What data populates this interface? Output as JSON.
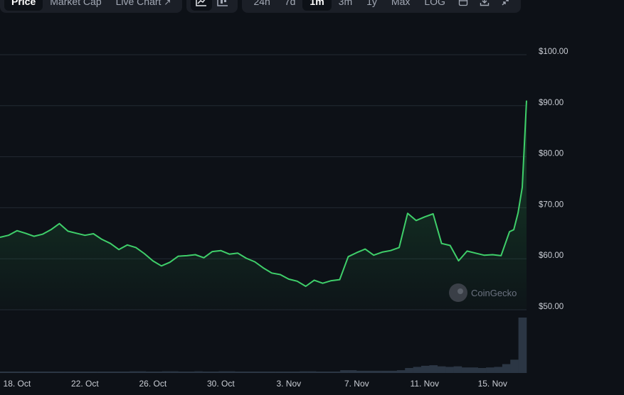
{
  "toolbar": {
    "view_tabs": [
      {
        "label": "Price",
        "active": true
      },
      {
        "label": "Market Cap",
        "active": false
      },
      {
        "label": "Live Chart",
        "active": false
      }
    ],
    "chart_type_icons": [
      {
        "icon": "line-chart-icon",
        "active": true
      },
      {
        "icon": "candlestick-chart-icon",
        "active": false
      }
    ],
    "ranges": [
      {
        "label": "24h",
        "active": false
      },
      {
        "label": "7d",
        "active": false
      },
      {
        "label": "1m",
        "active": true
      },
      {
        "label": "3m",
        "active": false
      },
      {
        "label": "1y",
        "active": false
      },
      {
        "label": "Max",
        "active": false
      },
      {
        "label": "LOG",
        "active": false
      }
    ],
    "action_icons": [
      "calendar-icon",
      "download-icon",
      "fullscreen-icon"
    ]
  },
  "watermark": "CoinGecko",
  "colors": {
    "background": "#0d1117",
    "line": "#3fcf6a",
    "grid": "#232a33",
    "volume": "#2b3644"
  },
  "chart_data": {
    "type": "area",
    "title": "",
    "xlabel": "",
    "ylabel": "",
    "ylim": [
      50,
      100
    ],
    "yticks": [
      "$50.00",
      "$60.00",
      "$70.00",
      "$80.00",
      "$90.00",
      "$100.00"
    ],
    "xticks": [
      "18. Oct",
      "22. Oct",
      "26. Oct",
      "30. Oct",
      "3. Nov",
      "7. Nov",
      "11. Nov",
      "15. Nov"
    ],
    "grid": true,
    "series": [
      {
        "values": [
          {
            "x": "2023-10-17",
            "y": 64.2
          },
          {
            "x": "2023-10-17T12",
            "y": 64.6
          },
          {
            "x": "2023-10-18",
            "y": 65.5
          },
          {
            "x": "2023-10-18T12",
            "y": 65.0
          },
          {
            "x": "2023-10-19",
            "y": 64.4
          },
          {
            "x": "2023-10-19T12",
            "y": 64.8
          },
          {
            "x": "2023-10-20",
            "y": 65.7
          },
          {
            "x": "2023-10-20T12",
            "y": 66.9
          },
          {
            "x": "2023-10-21",
            "y": 65.4
          },
          {
            "x": "2023-10-21T12",
            "y": 65.0
          },
          {
            "x": "2023-10-22",
            "y": 64.6
          },
          {
            "x": "2023-10-22T12",
            "y": 64.9
          },
          {
            "x": "2023-10-23",
            "y": 63.8
          },
          {
            "x": "2023-10-23T12",
            "y": 63.0
          },
          {
            "x": "2023-10-24",
            "y": 61.8
          },
          {
            "x": "2023-10-24T12",
            "y": 62.7
          },
          {
            "x": "2023-10-25",
            "y": 62.2
          },
          {
            "x": "2023-10-25T12",
            "y": 61.0
          },
          {
            "x": "2023-10-26",
            "y": 59.6
          },
          {
            "x": "2023-10-26T12",
            "y": 58.6
          },
          {
            "x": "2023-10-27",
            "y": 59.3
          },
          {
            "x": "2023-10-27T12",
            "y": 60.5
          },
          {
            "x": "2023-10-28",
            "y": 60.6
          },
          {
            "x": "2023-10-28T12",
            "y": 60.8
          },
          {
            "x": "2023-10-29",
            "y": 60.2
          },
          {
            "x": "2023-10-29T12",
            "y": 61.4
          },
          {
            "x": "2023-10-30",
            "y": 61.6
          },
          {
            "x": "2023-10-30T12",
            "y": 60.9
          },
          {
            "x": "2023-10-31",
            "y": 61.1
          },
          {
            "x": "2023-10-31T12",
            "y": 60.1
          },
          {
            "x": "2023-11-01",
            "y": 59.4
          },
          {
            "x": "2023-11-01T12",
            "y": 58.2
          },
          {
            "x": "2023-11-02",
            "y": 57.2
          },
          {
            "x": "2023-11-02T12",
            "y": 56.9
          },
          {
            "x": "2023-11-03",
            "y": 56.0
          },
          {
            "x": "2023-11-03T12",
            "y": 55.6
          },
          {
            "x": "2023-11-04",
            "y": 54.6
          },
          {
            "x": "2023-11-04T12",
            "y": 55.8
          },
          {
            "x": "2023-11-05",
            "y": 55.2
          },
          {
            "x": "2023-11-05T12",
            "y": 55.7
          },
          {
            "x": "2023-11-06",
            "y": 55.9
          },
          {
            "x": "2023-11-06T12",
            "y": 60.4
          },
          {
            "x": "2023-11-07",
            "y": 61.2
          },
          {
            "x": "2023-11-07T12",
            "y": 61.9
          },
          {
            "x": "2023-11-08",
            "y": 60.7
          },
          {
            "x": "2023-11-08T12",
            "y": 61.3
          },
          {
            "x": "2023-11-09",
            "y": 61.6
          },
          {
            "x": "2023-11-09T12",
            "y": 62.2
          },
          {
            "x": "2023-11-10",
            "y": 68.9
          },
          {
            "x": "2023-11-10T12",
            "y": 67.5
          },
          {
            "x": "2023-11-11",
            "y": 68.2
          },
          {
            "x": "2023-11-11T12",
            "y": 68.8
          },
          {
            "x": "2023-11-12",
            "y": 63.0
          },
          {
            "x": "2023-11-12T12",
            "y": 62.6
          },
          {
            "x": "2023-11-13",
            "y": 59.6
          },
          {
            "x": "2023-11-13T12",
            "y": 61.5
          },
          {
            "x": "2023-11-14",
            "y": 61.1
          },
          {
            "x": "2023-11-14T12",
            "y": 60.7
          },
          {
            "x": "2023-11-15",
            "y": 60.8
          },
          {
            "x": "2023-11-15T12",
            "y": 60.6
          },
          {
            "x": "2023-11-16",
            "y": 65.3
          },
          {
            "x": "2023-11-16T06",
            "y": 65.7
          },
          {
            "x": "2023-11-16T12",
            "y": 69.0
          },
          {
            "x": "2023-11-16T18",
            "y": 74.0
          },
          {
            "x": "2023-11-17",
            "y": 91.0
          }
        ]
      }
    ],
    "volume": [
      2,
      2,
      2,
      2,
      2,
      2,
      2,
      2,
      2,
      2,
      2,
      2,
      2,
      2,
      2,
      2,
      3,
      3,
      2,
      2,
      3,
      3,
      2,
      2,
      3,
      2,
      2,
      3,
      3,
      2,
      2,
      2,
      2,
      2,
      2,
      2,
      2,
      3,
      3,
      2,
      2,
      2,
      5,
      5,
      4,
      4,
      4,
      4,
      4,
      5,
      9,
      11,
      13,
      14,
      12,
      11,
      12,
      10,
      10,
      9,
      10,
      11,
      16,
      24,
      100
    ]
  }
}
